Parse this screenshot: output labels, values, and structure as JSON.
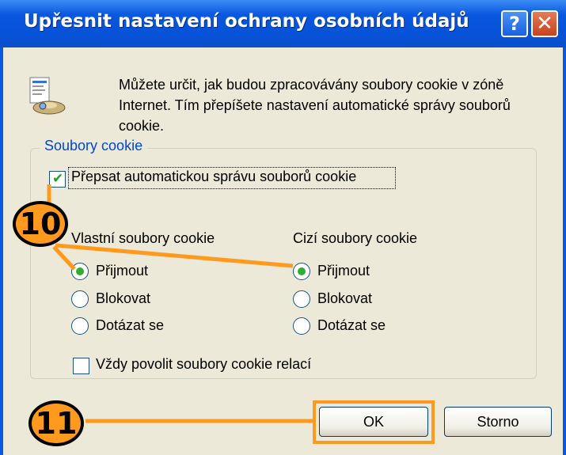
{
  "window": {
    "title": "Upřesnit nastavení ochrany osobních údajů",
    "help_button": "?",
    "close_button": "✕"
  },
  "intro": {
    "text": "Můžete určit, jak budou zpracovávány soubory cookie v zóně Internet. Tím přepíšete nastavení automatické správy souborů cookie."
  },
  "group": {
    "label": "Soubory cookie",
    "override_checkbox": {
      "label": "Přepsat automatickou správu souborů cookie",
      "checked": true
    },
    "first_party": {
      "header": "Vlastní soubory cookie",
      "options": [
        "Přijmout",
        "Blokovat",
        "Dotázat se"
      ],
      "selected": "Přijmout"
    },
    "third_party": {
      "header": "Cizí soubory cookie",
      "options": [
        "Přijmout",
        "Blokovat",
        "Dotázat se"
      ],
      "selected": "Přijmout"
    },
    "session_checkbox": {
      "label": "Vždy povolit soubory cookie relací",
      "checked": false
    }
  },
  "buttons": {
    "ok": "OK",
    "cancel": "Storno"
  },
  "annotations": {
    "step_10": "10",
    "step_11": "11",
    "color": "#ff9a1e"
  }
}
